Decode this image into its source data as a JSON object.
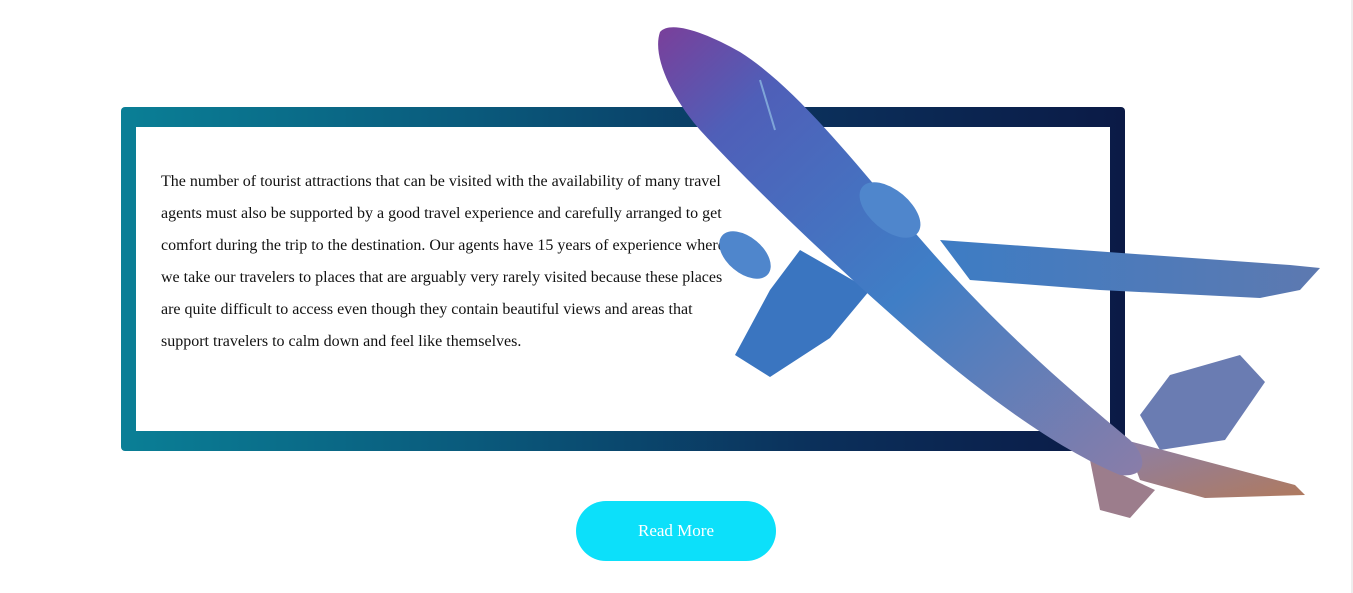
{
  "intro": {
    "body": "The number of tourist attractions that can be visited with the availability of many travel agents must also be supported by a good travel experience and carefully arranged to get comfort during the trip to the destination. Our agents have 15 years of experience where we take our travelers to places that are arguably very rarely visited because these places are quite difficult to access even though they contain beautiful views and areas that support travelers to calm down and feel like themselves.",
    "read_more_label": "Read More"
  },
  "colors": {
    "frame_gradient_start": "#0a7f96",
    "frame_gradient_end": "#0b1a46",
    "button_background": "#0ce0fa",
    "button_text": "#ffffff",
    "plane_body_blue": "#3d7cc4",
    "plane_nose_purple": "#7a3f9a"
  },
  "decor": {
    "hero_image": "airplane-image"
  }
}
